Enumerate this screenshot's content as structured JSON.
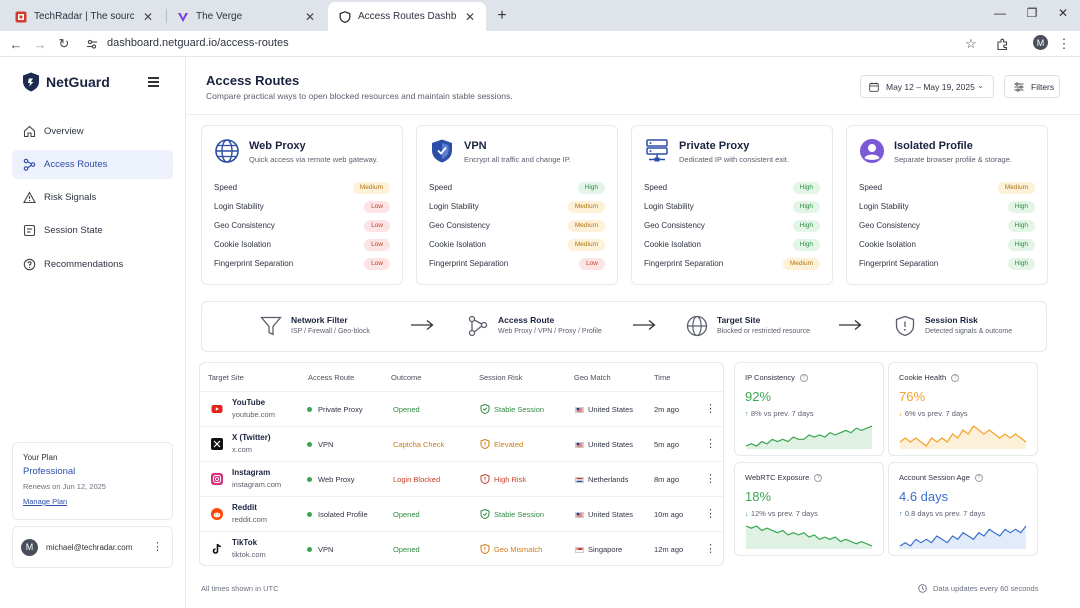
{
  "browser": {
    "tabs": [
      {
        "label": "TechRadar | The source for tech",
        "icon": "techradar-favicon",
        "active": false
      },
      {
        "label": "The Verge",
        "icon": "verge-favicon",
        "active": false
      },
      {
        "label": "Access Routes Dashboard",
        "icon": "netguard-favicon",
        "active": true
      }
    ],
    "url": "dashboard.netguard.io/access-routes",
    "profile_initial": "M"
  },
  "sidebar": {
    "brand": "NetGuard",
    "items": [
      {
        "label": "Overview",
        "icon": "home-icon",
        "active": false
      },
      {
        "label": "Access Routes",
        "icon": "routes-icon",
        "active": true
      },
      {
        "label": "Risk Signals",
        "icon": "warning-icon",
        "active": false
      },
      {
        "label": "Session State",
        "icon": "session-icon",
        "active": false
      },
      {
        "label": "Recommendations",
        "icon": "help-icon",
        "active": false
      }
    ],
    "plan": {
      "heading": "Your Plan",
      "name": "Professional",
      "renews": "Renews on Jun 12, 2025",
      "manage": "Manage Plan"
    },
    "user": {
      "initial": "M",
      "email": "michael@techradar.com"
    }
  },
  "header": {
    "title": "Access Routes",
    "subtitle": "Compare practical ways to open blocked resources and maintain stable sessions.",
    "date_range": "May 12 – May 19, 2025",
    "filters_label": "Filters"
  },
  "cards": [
    {
      "title": "Web Proxy",
      "desc": "Quick access via remote web gateway.",
      "icon": "globe-icon",
      "metrics": [
        {
          "label": "Speed",
          "level": "Medium"
        },
        {
          "label": "Login Stability",
          "level": "Low"
        },
        {
          "label": "Geo Consistency",
          "level": "Low"
        },
        {
          "label": "Cookie Isolation",
          "level": "Low"
        },
        {
          "label": "Fingerprint Separation",
          "level": "Low"
        }
      ]
    },
    {
      "title": "VPN",
      "desc": "Encrypt all traffic and change IP.",
      "icon": "shield-icon",
      "metrics": [
        {
          "label": "Speed",
          "level": "High"
        },
        {
          "label": "Login Stability",
          "level": "Medium"
        },
        {
          "label": "Geo Consistency",
          "level": "Medium"
        },
        {
          "label": "Cookie Isolation",
          "level": "Medium"
        },
        {
          "label": "Fingerprint Separation",
          "level": "Low"
        }
      ]
    },
    {
      "title": "Private Proxy",
      "desc": "Dedicated IP with consistent exit.",
      "icon": "server-icon",
      "metrics": [
        {
          "label": "Speed",
          "level": "High"
        },
        {
          "label": "Login Stability",
          "level": "High"
        },
        {
          "label": "Geo Consistency",
          "level": "High"
        },
        {
          "label": "Cookie Isolation",
          "level": "High"
        },
        {
          "label": "Fingerprint Separation",
          "level": "Medium"
        }
      ]
    },
    {
      "title": "Isolated Profile",
      "desc": "Separate browser profile & storage.",
      "icon": "profile-icon",
      "metrics": [
        {
          "label": "Speed",
          "level": "Medium"
        },
        {
          "label": "Login Stability",
          "level": "High"
        },
        {
          "label": "Geo Consistency",
          "level": "High"
        },
        {
          "label": "Cookie Isolation",
          "level": "High"
        },
        {
          "label": "Fingerprint Separation",
          "level": "High"
        }
      ]
    }
  ],
  "flow": [
    {
      "title": "Network Filter",
      "sub": "ISP / Firewall / Geo-block",
      "icon": "funnel-icon"
    },
    {
      "title": "Access Route",
      "sub": "Web Proxy / VPN / Proxy / Profile",
      "icon": "route-icon"
    },
    {
      "title": "Target Site",
      "sub": "Blocked or restricted resource",
      "icon": "globe-icon"
    },
    {
      "title": "Session Risk",
      "sub": "Detected signals & outcome",
      "icon": "shield-alert-icon"
    }
  ],
  "table": {
    "headers": [
      "Target Site",
      "Access Route",
      "Outcome",
      "Session Risk",
      "Geo Match",
      "Time"
    ],
    "rows": [
      {
        "site": "YouTube",
        "url": "youtube.com",
        "icon": "youtube-icon",
        "route": "Private Proxy",
        "outcome": "Opened",
        "outcome_tone": "green",
        "risk": "Stable Session",
        "risk_tone": "green",
        "geo": "United States",
        "flag": "us-flag",
        "time": "2m ago"
      },
      {
        "site": "X (Twitter)",
        "url": "x.com",
        "icon": "x-icon",
        "route": "VPN",
        "outcome": "Captcha Check",
        "outcome_tone": "orange",
        "risk": "Elevated",
        "risk_tone": "orange",
        "geo": "United States",
        "flag": "us-flag",
        "time": "5m ago"
      },
      {
        "site": "Instagram",
        "url": "instagram.com",
        "icon": "instagram-icon",
        "route": "Web Proxy",
        "outcome": "Login Blocked",
        "outcome_tone": "red",
        "risk": "High Risk",
        "risk_tone": "red",
        "geo": "Netherlands",
        "flag": "nl-flag",
        "time": "8m ago"
      },
      {
        "site": "Reddit",
        "url": "reddit.com",
        "icon": "reddit-icon",
        "route": "Isolated Profile",
        "outcome": "Opened",
        "outcome_tone": "green",
        "risk": "Stable Session",
        "risk_tone": "green",
        "geo": "United States",
        "flag": "us-flag",
        "time": "10m ago"
      },
      {
        "site": "TikTok",
        "url": "tiktok.com",
        "icon": "tiktok-icon",
        "route": "VPN",
        "outcome": "Opened",
        "outcome_tone": "green",
        "risk": "Geo Mismatch",
        "risk_tone": "orange",
        "geo": "Singapore",
        "flag": "sg-flag",
        "time": "12m ago"
      }
    ]
  },
  "stats": [
    {
      "title": "IP Consistency",
      "value": "92%",
      "delta": "8% vs prev. 7 days",
      "arrow": "↑",
      "color": "#3aa652",
      "fill": "#dff1e2",
      "series": [
        3,
        4,
        3,
        5,
        4,
        6,
        5,
        6,
        5,
        7,
        6,
        6,
        8,
        7,
        8,
        7,
        9,
        8,
        9,
        10,
        9,
        11,
        10,
        11,
        12
      ]
    },
    {
      "title": "Cookie Health",
      "value": "76%",
      "delta": "6% vs prev. 7 days",
      "arrow": "↓",
      "color": "#f0a22a",
      "fill": "#fdf0d8",
      "series": [
        7,
        8,
        7,
        8,
        7,
        6,
        8,
        7,
        8,
        7,
        9,
        8,
        10,
        9,
        11,
        10,
        9,
        10,
        9,
        8,
        9,
        8,
        9,
        8,
        7
      ]
    },
    {
      "title": "WebRTC Exposure",
      "value": "18%",
      "delta": "12% vs prev. 7 days",
      "arrow": "↓",
      "color": "#3aa652",
      "fill": "#dff1e2",
      "series": [
        12,
        11,
        12,
        10,
        11,
        10,
        9,
        10,
        8,
        9,
        8,
        9,
        7,
        8,
        6,
        7,
        6,
        7,
        5,
        6,
        5,
        4,
        5,
        4,
        3
      ]
    },
    {
      "title": "Account Session Age",
      "value": "4.6 days",
      "delta": "0.8 days vs prev. 7 days",
      "arrow": "↑",
      "color": "#3a6fd0",
      "fill": "#e2ebfa",
      "series": [
        4,
        5,
        4,
        6,
        5,
        6,
        5,
        7,
        6,
        5,
        7,
        6,
        8,
        7,
        6,
        8,
        7,
        9,
        8,
        7,
        9,
        8,
        9,
        8,
        10
      ]
    }
  ],
  "footer": {
    "left": "All times shown in UTC",
    "right": "Data updates every 60 seconds"
  }
}
